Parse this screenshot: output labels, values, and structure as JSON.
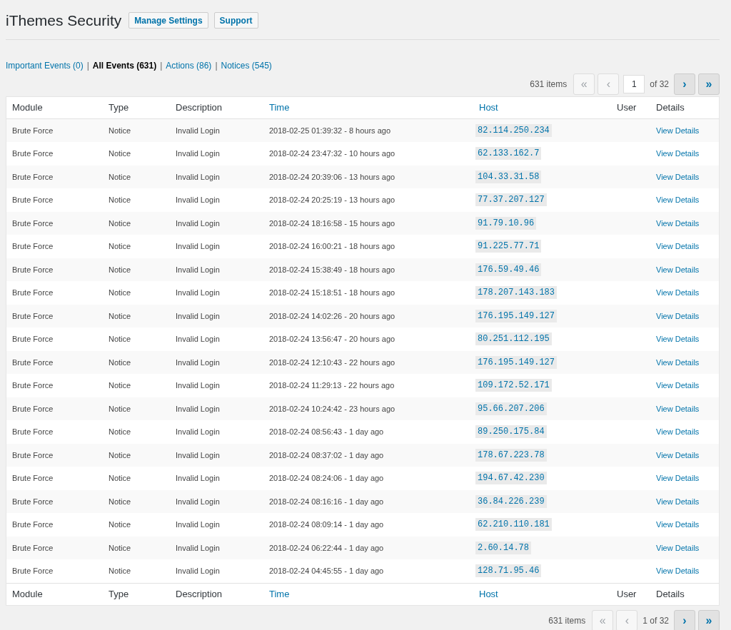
{
  "header": {
    "title": "iThemes Security",
    "buttons": [
      "Manage Settings",
      "Support"
    ]
  },
  "filters": [
    {
      "label": "Important Events (0)",
      "selected": false,
      "separator": "|"
    },
    {
      "label": "All Events (631)",
      "selected": true,
      "separator": "|"
    },
    {
      "label": "Actions (86)",
      "selected": false,
      "separator": "|"
    },
    {
      "label": "Notices (545)",
      "selected": false
    }
  ],
  "pagination_top": {
    "count": "631 items",
    "first": {
      "label": "«",
      "disabled": true
    },
    "prev": {
      "label": "‹",
      "disabled": true
    },
    "page_input": "1",
    "of": "of 32",
    "next": {
      "label": "›",
      "disabled": false
    },
    "last": {
      "label": "»",
      "disabled": false
    }
  },
  "table": {
    "columns": [
      {
        "label": "Module",
        "sortable": false
      },
      {
        "label": "Type",
        "sortable": false
      },
      {
        "label": "Description",
        "sortable": false
      },
      {
        "label": "Time",
        "sortable": true
      },
      {
        "label": "Host",
        "sortable": true
      },
      {
        "label": "User",
        "sortable": false
      },
      {
        "label": "Details",
        "sortable": false
      }
    ],
    "rows": [
      {
        "module": "Brute Force",
        "type": "Notice",
        "description": "Invalid Login",
        "time": "2018-02-25 01:39:32 - 8 hours ago",
        "host": "82.114.250.234",
        "details": "View Details"
      },
      {
        "module": "Brute Force",
        "type": "Notice",
        "description": "Invalid Login",
        "time": "2018-02-24 23:47:32 - 10 hours ago",
        "host": "62.133.162.7",
        "details": "View Details"
      },
      {
        "module": "Brute Force",
        "type": "Notice",
        "description": "Invalid Login",
        "time": "2018-02-24 20:39:06 - 13 hours ago",
        "host": "104.33.31.58",
        "details": "View Details"
      },
      {
        "module": "Brute Force",
        "type": "Notice",
        "description": "Invalid Login",
        "time": "2018-02-24 20:25:19 - 13 hours ago",
        "host": "77.37.207.127",
        "details": "View Details"
      },
      {
        "module": "Brute Force",
        "type": "Notice",
        "description": "Invalid Login",
        "time": "2018-02-24 18:16:58 - 15 hours ago",
        "host": "91.79.10.96",
        "details": "View Details"
      },
      {
        "module": "Brute Force",
        "type": "Notice",
        "description": "Invalid Login",
        "time": "2018-02-24 16:00:21 - 18 hours ago",
        "host": "91.225.77.71",
        "details": "View Details"
      },
      {
        "module": "Brute Force",
        "type": "Notice",
        "description": "Invalid Login",
        "time": "2018-02-24 15:38:49 - 18 hours ago",
        "host": "176.59.49.46",
        "details": "View Details"
      },
      {
        "module": "Brute Force",
        "type": "Notice",
        "description": "Invalid Login",
        "time": "2018-02-24 15:18:51 - 18 hours ago",
        "host": "178.207.143.183",
        "details": "View Details"
      },
      {
        "module": "Brute Force",
        "type": "Notice",
        "description": "Invalid Login",
        "time": "2018-02-24 14:02:26 - 20 hours ago",
        "host": "176.195.149.127",
        "details": "View Details"
      },
      {
        "module": "Brute Force",
        "type": "Notice",
        "description": "Invalid Login",
        "time": "2018-02-24 13:56:47 - 20 hours ago",
        "host": "80.251.112.195",
        "details": "View Details"
      },
      {
        "module": "Brute Force",
        "type": "Notice",
        "description": "Invalid Login",
        "time": "2018-02-24 12:10:43 - 22 hours ago",
        "host": "176.195.149.127",
        "details": "View Details"
      },
      {
        "module": "Brute Force",
        "type": "Notice",
        "description": "Invalid Login",
        "time": "2018-02-24 11:29:13 - 22 hours ago",
        "host": "109.172.52.171",
        "details": "View Details"
      },
      {
        "module": "Brute Force",
        "type": "Notice",
        "description": "Invalid Login",
        "time": "2018-02-24 10:24:42 - 23 hours ago",
        "host": "95.66.207.206",
        "details": "View Details"
      },
      {
        "module": "Brute Force",
        "type": "Notice",
        "description": "Invalid Login",
        "time": "2018-02-24 08:56:43 - 1 day ago",
        "host": "89.250.175.84",
        "details": "View Details"
      },
      {
        "module": "Brute Force",
        "type": "Notice",
        "description": "Invalid Login",
        "time": "2018-02-24 08:37:02 - 1 day ago",
        "host": "178.67.223.78",
        "details": "View Details"
      },
      {
        "module": "Brute Force",
        "type": "Notice",
        "description": "Invalid Login",
        "time": "2018-02-24 08:24:06 - 1 day ago",
        "host": "194.67.42.230",
        "details": "View Details"
      },
      {
        "module": "Brute Force",
        "type": "Notice",
        "description": "Invalid Login",
        "time": "2018-02-24 08:16:16 - 1 day ago",
        "host": "36.84.226.239",
        "details": "View Details"
      },
      {
        "module": "Brute Force",
        "type": "Notice",
        "description": "Invalid Login",
        "time": "2018-02-24 08:09:14 - 1 day ago",
        "host": "62.210.110.181",
        "details": "View Details"
      },
      {
        "module": "Brute Force",
        "type": "Notice",
        "description": "Invalid Login",
        "time": "2018-02-24 06:22:44 - 1 day ago",
        "host": "2.60.14.78",
        "details": "View Details"
      },
      {
        "module": "Brute Force",
        "type": "Notice",
        "description": "Invalid Login",
        "time": "2018-02-24 04:45:55 - 1 day ago",
        "host": "128.71.95.46",
        "details": "View Details"
      }
    ],
    "footer_columns": [
      {
        "label": "Module",
        "sortable": false
      },
      {
        "label": "Type",
        "sortable": false
      },
      {
        "label": "Description",
        "sortable": false
      },
      {
        "label": "Time",
        "sortable": true
      },
      {
        "label": "Host",
        "sortable": true
      },
      {
        "label": "User",
        "sortable": false
      },
      {
        "label": "Details",
        "sortable": false
      }
    ]
  },
  "pagination_bottom": {
    "count": "631 items",
    "first": {
      "label": "«",
      "disabled": true
    },
    "prev": {
      "label": "‹",
      "disabled": true
    },
    "page_text": "1 of 32",
    "next": {
      "label": "›",
      "disabled": false
    },
    "last": {
      "label": "»",
      "disabled": false
    }
  }
}
